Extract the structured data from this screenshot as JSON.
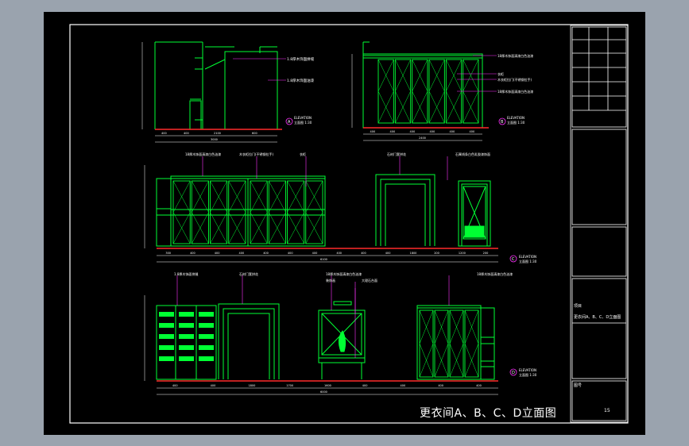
{
  "drawing": {
    "title": "更衣间A、B、C、D立面图",
    "scale_label": "立面图 1:30",
    "elevation_label": "ELEVATION",
    "colors": {
      "background": "#000000",
      "frame": "#ffffff",
      "linework": "#00ff33",
      "annotation": "#ff33ff",
      "floor_line": "#ff2a2a",
      "outline": "#ffffff",
      "window_bg": "#9aa3ae"
    }
  },
  "views": [
    {
      "id": "A",
      "dims": [
        "400",
        "400",
        "2100",
        "600"
      ],
      "total": "3000",
      "callouts": [
        "1.8厚木饰面拼缝",
        "1.8厚木饰面油漆"
      ]
    },
    {
      "id": "B",
      "dims": [
        "400",
        "400",
        "400",
        "400",
        "400",
        "400"
      ],
      "total": "2400",
      "callouts": [
        "18厚木饰面清漆白色油漆",
        "衣柜",
        "木衣柜拉门(不锈钢拉手)",
        "18厚木饰面清漆白色油漆"
      ]
    },
    {
      "id": "C",
      "dims": [
        "300",
        "400",
        "400",
        "400",
        "400",
        "400",
        "400",
        "400",
        "400",
        "400",
        "1800",
        "200",
        "1200",
        "200"
      ],
      "total": "6100",
      "callouts": [
        "18厚木饰面清漆白色油漆",
        "木衣柜拉门(不锈钢拉手)",
        "衣柜",
        "石材门套拼花",
        "石膏线条白色乳胶漆饰面"
      ]
    },
    {
      "id": "D",
      "dims": [
        "400",
        "400",
        "1800",
        "1700",
        "1600",
        "400",
        "400",
        "400",
        "400"
      ],
      "total": "6000",
      "callouts": [
        "1.8厚木饰面拼缝",
        "石材门套拼花",
        "18厚木饰面清漆白色油漆",
        "装饰画",
        "大理石台面",
        "18厚木饰面清漆白色油漆"
      ]
    }
  ],
  "title_block": {
    "project_label": "项目",
    "sheet_title": "更衣间A、B、C、D立面图",
    "drawing_no_label": "图号",
    "drawing_no": "15"
  }
}
